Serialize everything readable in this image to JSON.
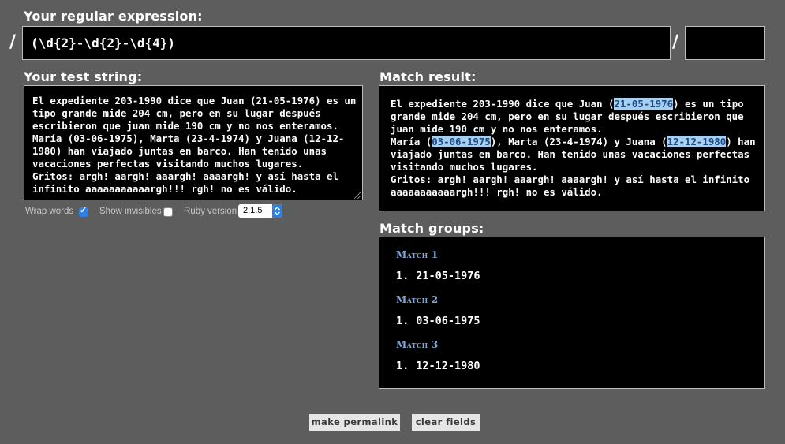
{
  "regex": {
    "label": "Your regular expression:",
    "value": "(\\d{2}-\\d{2}-\\d{4})",
    "slash_open": "/",
    "slash_close": "/",
    "options_value": ""
  },
  "test": {
    "label": "Your test string:",
    "lines": [
      "El expediente 203-1990 dice que Juan (21-05-1976) es un",
      "tipo grande mide 204 cm, pero en su lugar después",
      "escribieron que juan mide 190 cm y no nos enteramos.",
      "María (03-06-1975), Marta (23-4-1974) y Juana (12-12-",
      "1980) han viajado juntas en barco. Han tenido unas",
      "vacaciones perfectas visitando muchos lugares.",
      "Gritos: argh! aargh! aaargh! aaaargh! y así hasta el",
      "infinito aaaaaaaaaaargh!!! rgh! no es válido."
    ]
  },
  "options": {
    "wrap_words_label": "Wrap words",
    "wrap_words_checked": true,
    "show_invisibles_label": "Show invisibles",
    "show_invisibles_checked": false,
    "ruby_version_label": "Ruby version",
    "ruby_version_value": "2.1.5"
  },
  "result": {
    "label": "Match result:",
    "lines": [
      [
        {
          "t": "El expediente 203-1990 dice que Juan ("
        },
        {
          "t": "21-05-1976",
          "hl": true
        },
        {
          "t": ") es un tipo"
        }
      ],
      [
        {
          "t": "grande mide 204 cm, pero en su lugar después escribieron que"
        }
      ],
      [
        {
          "t": "juan mide 190 cm y no nos enteramos."
        }
      ],
      [
        {
          "t": "María ("
        },
        {
          "t": "03-06-1975",
          "hl": true
        },
        {
          "t": "), Marta (23-4-1974) y Juana ("
        },
        {
          "t": "12-12-1980",
          "hl": true
        },
        {
          "t": ") han"
        }
      ],
      [
        {
          "t": "viajado juntas en barco. Han tenido unas vacaciones perfectas"
        }
      ],
      [
        {
          "t": "visitando muchos lugares."
        }
      ],
      [
        {
          "t": "Gritos: argh! aargh! aaargh! aaaargh! y así hasta el infinito"
        }
      ],
      [
        {
          "t": "aaaaaaaaaaargh!!! rgh! no es válido."
        }
      ]
    ]
  },
  "groups": {
    "label": "Match groups:",
    "matches": [
      {
        "title": "Match 1",
        "items": [
          {
            "num": "1.",
            "value": "21-05-1976"
          }
        ]
      },
      {
        "title": "Match 2",
        "items": [
          {
            "num": "1.",
            "value": "03-06-1975"
          }
        ]
      },
      {
        "title": "Match 3",
        "items": [
          {
            "num": "1.",
            "value": "12-12-1980"
          }
        ]
      }
    ]
  },
  "buttons": {
    "permalink": "make permalink",
    "clear": "clear fields"
  },
  "colors": {
    "background": "#5d5d5d",
    "highlight": "#a9cfee",
    "group_title": "#7ea7d6",
    "checkbox_on": "#2d7fe6"
  }
}
